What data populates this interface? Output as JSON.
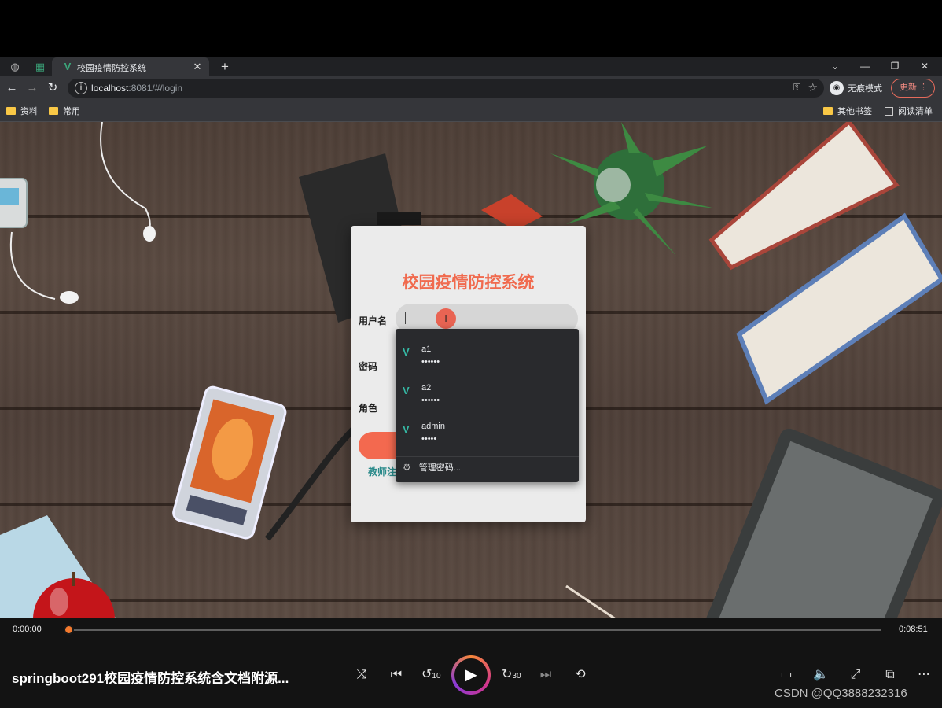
{
  "browser": {
    "tab": {
      "title": "校园疫情防控系统",
      "favicon": "V"
    },
    "url": {
      "host": "localhost",
      "rest": ":8081/#/login"
    },
    "incognito_label": "无痕模式",
    "update_label": "更新",
    "bookmarks": {
      "left": [
        "资料",
        "常用"
      ],
      "other": "其他书签",
      "reading": "阅读清单"
    }
  },
  "login": {
    "title": "校园疫情防控系统",
    "labels": {
      "username": "用户名",
      "password": "密码",
      "role": "角色"
    },
    "register_link": "教师注"
  },
  "password_dropdown": {
    "items": [
      {
        "user": "a1",
        "mask": "••••••"
      },
      {
        "user": "a2",
        "mask": "••••••"
      },
      {
        "user": "admin",
        "mask": "•••••"
      }
    ],
    "manage_label": "管理密码..."
  },
  "player": {
    "current_time": "0:00:00",
    "total_time": "0:08:51",
    "progress": 0.0,
    "title": "springboot291校园疫情防控系统含文档附源...",
    "rewind_label": "10",
    "forward_label": "30",
    "watermark": "CSDN @QQ3888232316",
    "accent_colors": [
      "#f6873a",
      "#d2358c",
      "#8a3ad6"
    ]
  }
}
